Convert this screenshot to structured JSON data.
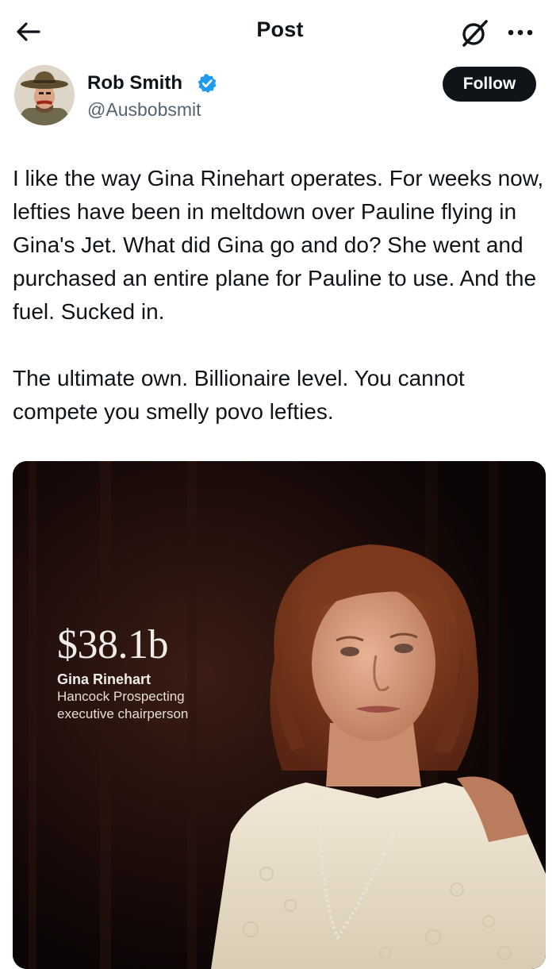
{
  "header": {
    "title": "Post",
    "back_icon": "arrow-left-icon",
    "grok_icon": "grok-slash-icon",
    "more_icon": "more-dots-icon"
  },
  "author": {
    "name": "Rob Smith",
    "handle": "@Ausbobsmit",
    "verified": true,
    "verified_color": "#1d9bf0",
    "follow_label": "Follow"
  },
  "post": {
    "paragraphs": [
      "I like the way Gina Rinehart operates. For weeks now, lefties have been in meltdown over Pauline flying in Gina's Jet. What did Gina go and do? She went and purchased an entire plane for Pauline to use. And the fuel. Sucked in.",
      "The ultimate own. Billionaire level. You cannot compete you smelly povo lefties."
    ]
  },
  "media": {
    "amount": "$38.1b",
    "name": "Gina Rinehart",
    "company": "Hancock Prospecting",
    "role": "executive chairperson"
  },
  "colors": {
    "text": "#0f1419",
    "secondary_text": "#536471",
    "follow_bg": "#0f1419",
    "follow_text": "#ffffff",
    "accent": "#1d9bf0"
  }
}
